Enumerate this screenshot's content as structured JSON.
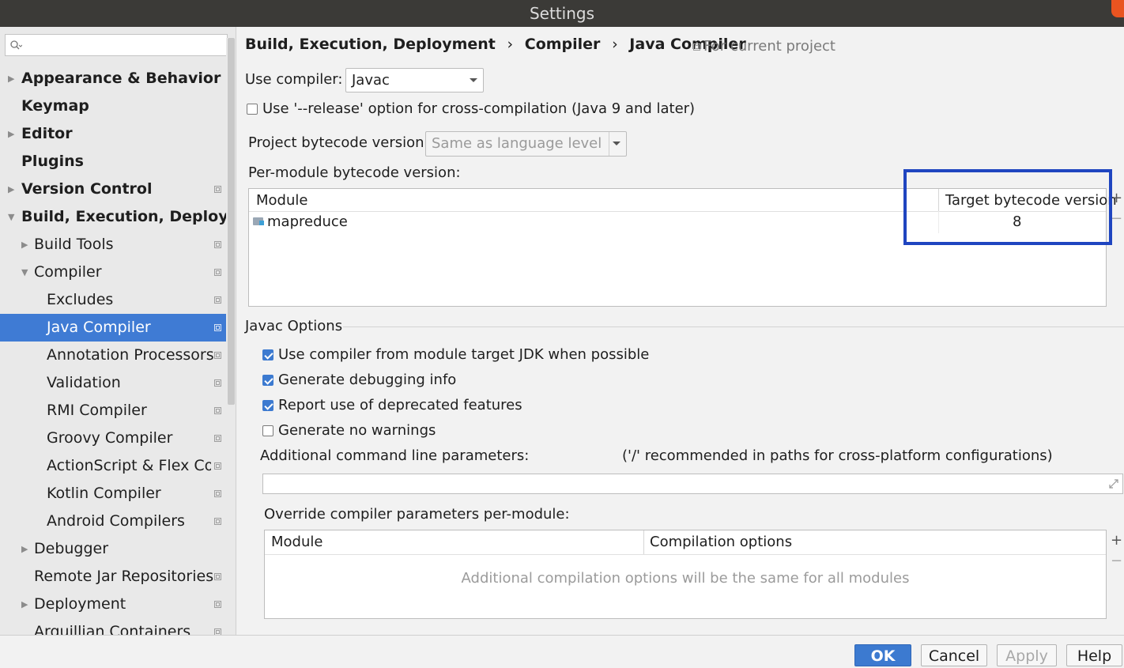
{
  "window": {
    "title": "Settings"
  },
  "sidebar": {
    "search_placeholder": "",
    "items": [
      {
        "label": "Appearance & Behavior"
      },
      {
        "label": "Keymap"
      },
      {
        "label": "Editor"
      },
      {
        "label": "Plugins"
      },
      {
        "label": "Version Control"
      },
      {
        "label": "Build, Execution, Deploymen"
      },
      {
        "label": "Build Tools"
      },
      {
        "label": "Compiler"
      },
      {
        "label": "Excludes"
      },
      {
        "label": "Java Compiler"
      },
      {
        "label": "Annotation Processors"
      },
      {
        "label": "Validation"
      },
      {
        "label": "RMI Compiler"
      },
      {
        "label": "Groovy Compiler"
      },
      {
        "label": "ActionScript & Flex Comp"
      },
      {
        "label": "Kotlin Compiler"
      },
      {
        "label": "Android Compilers"
      },
      {
        "label": "Debugger"
      },
      {
        "label": "Remote Jar Repositories"
      },
      {
        "label": "Deployment"
      },
      {
        "label": "Arquillian Containers"
      }
    ]
  },
  "breadcrumb": {
    "parts": [
      "Build, Execution, Deployment",
      "Compiler",
      "Java Compiler"
    ],
    "separator": "›",
    "scope": "For current project"
  },
  "compiler": {
    "use_compiler_label": "Use compiler:",
    "use_compiler_value": "Javac",
    "release_option_label": "Use '--release' option for cross-compilation (Java 9 and later)",
    "release_option_checked": false,
    "project_bytecode_label": "Project bytecode version:",
    "project_bytecode_value": "Same as language level",
    "per_module_label": "Per-module bytecode version:",
    "module_table": {
      "columns": [
        "Module",
        "Target bytecode version"
      ],
      "rows": [
        {
          "module": "mapreduce",
          "target": "8"
        }
      ]
    }
  },
  "javac": {
    "section_label": "Javac Options",
    "options": [
      {
        "label": "Use compiler from module target JDK when possible",
        "checked": true
      },
      {
        "label": "Generate debugging info",
        "checked": true
      },
      {
        "label": "Report use of deprecated features",
        "checked": true
      },
      {
        "label": "Generate no warnings",
        "checked": false
      }
    ],
    "additional_params_label": "Additional command line parameters:",
    "additional_params_hint": "('/' recommended in paths for cross-platform configurations)",
    "additional_params_value": "",
    "override_label": "Override compiler parameters per-module:",
    "override_table": {
      "columns": [
        "Module",
        "Compilation options"
      ],
      "empty_text": "Additional compilation options will be the same for all modules"
    }
  },
  "table_actions": {
    "add": "+",
    "remove": "−"
  },
  "buttons": {
    "ok": "OK",
    "cancel": "Cancel",
    "apply": "Apply",
    "help": "Help"
  },
  "colors": {
    "selection": "#3f7bd4",
    "highlight_box": "#1f45c0",
    "ok_button": "#3c7ad0"
  },
  "icons": [
    "search-icon",
    "folder-module-icon",
    "project-scope-icon",
    "expand-icon",
    "expand-arrow-icon",
    "collapse-arrow-icon"
  ]
}
